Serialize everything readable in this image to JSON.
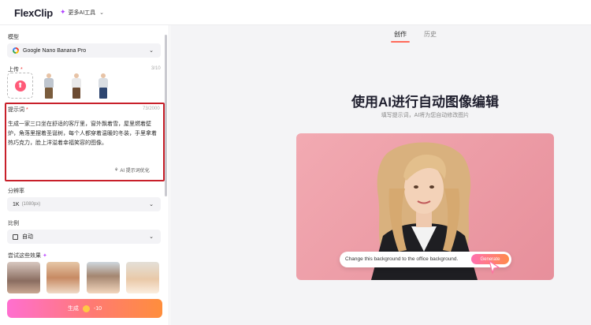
{
  "header": {
    "logo_text": "FlexClip",
    "ai_tools": "更多AI工具"
  },
  "left": {
    "model_label": "模型",
    "model_value": "Google Nano Banana Pro",
    "upload_label": "上传",
    "upload_required": "*",
    "upload_count": "3/10",
    "prompt_label": "提示词",
    "prompt_required": "*",
    "prompt_count": "73/2000",
    "prompt_text": "生成一家三口坐在舒适的客厅里，窗外飘着雪，屋里燃着壁炉，角落里摆着圣诞树，每个人都穿着温暖的冬装，手里拿着热巧克力，脸上洋溢着幸福笑容的图像。",
    "optimize_label": "AI 提示词优化",
    "resolution_label": "分辨率",
    "resolution_value": "1K",
    "resolution_hint": "(1080px)",
    "ratio_label": "比例",
    "ratio_value": "自动",
    "try_label": "尝试这些效果",
    "generate_label": "生成",
    "generate_cost": "-10"
  },
  "right": {
    "tabs": [
      {
        "label": "创作",
        "active": true
      },
      {
        "label": "历史",
        "active": false
      }
    ],
    "title": "使用AI进行自动图像编辑",
    "subtitle": "填写提示词，AI将为您自动修改图片",
    "demo_prompt": "Change this background to the office background.",
    "demo_button": "Generate"
  },
  "colors": {
    "accent": "#ff6a5a",
    "prompt_border": "#c8202a",
    "hero_bg": "#ec9ba5"
  }
}
